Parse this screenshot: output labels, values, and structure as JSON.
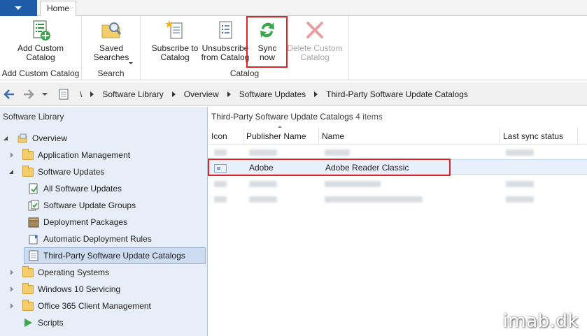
{
  "ribbon": {
    "tab_home": "Home",
    "groups": {
      "add_custom_catalog": "Add Custom Catalog",
      "search": "Search",
      "catalog": "Catalog"
    },
    "buttons": {
      "add_custom_catalog": "Add Custom\nCatalog",
      "saved_searches": "Saved\nSearches",
      "subscribe": "Subscribe to\nCatalog",
      "unsubscribe": "Unsubscribe\nfrom Catalog",
      "sync_now": "Sync\nnow",
      "delete_custom_catalog": "Delete Custom\nCatalog"
    }
  },
  "address": {
    "root": "\\",
    "crumbs": [
      "Software Library",
      "Overview",
      "Software Updates",
      "Third-Party Software Update Catalogs"
    ]
  },
  "nav": {
    "title": "Software Library",
    "items": [
      "Overview",
      "Application Management",
      "Software Updates",
      "All Software Updates",
      "Software Update Groups",
      "Deployment Packages",
      "Automatic Deployment Rules",
      "Third-Party Software Update Catalogs",
      "Operating Systems",
      "Windows 10 Servicing",
      "Office 365 Client Management",
      "Scripts"
    ]
  },
  "content": {
    "title": "Third-Party Software Update Catalogs",
    "count": "4 items",
    "columns": [
      "Icon",
      "Publisher Name",
      "Name",
      "Last sync status"
    ],
    "selected_row": {
      "publisher": "Adobe",
      "name": "Adobe Reader Classic"
    }
  },
  "watermark": "imab.dk",
  "colors": {
    "file_tab": "#1e5ba8",
    "highlight_box": "#d9262b",
    "nav_bg": "#e8eef7",
    "selection": "#cddcf0"
  }
}
